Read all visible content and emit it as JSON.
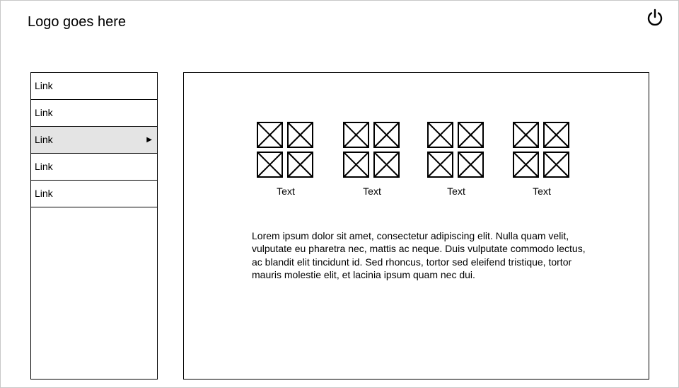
{
  "header": {
    "logo_text": "Logo goes here",
    "power_icon": "power-icon"
  },
  "sidebar": {
    "items": [
      {
        "label": "Link",
        "active": false
      },
      {
        "label": "Link",
        "active": false
      },
      {
        "label": "Link",
        "active": true,
        "arrow": "▶"
      },
      {
        "label": "Link",
        "active": false
      },
      {
        "label": "Link",
        "active": false
      }
    ]
  },
  "main": {
    "tiles": [
      {
        "label": "Text",
        "icon": "image-placeholder-icon"
      },
      {
        "label": "Text",
        "icon": "image-placeholder-icon"
      },
      {
        "label": "Text",
        "icon": "image-placeholder-icon"
      },
      {
        "label": "Text",
        "icon": "image-placeholder-icon"
      }
    ],
    "paragraph": "Lorem ipsum dolor sit amet, consectetur adipiscing elit. Nulla quam velit, vulputate eu pharetra nec, mattis ac neque. Duis vulputate commodo lectus, ac blandit elit tincidunt id. Sed rhoncus, tortor sed eleifend tristique, tortor mauris molestie elit, et lacinia ipsum quam nec dui."
  }
}
